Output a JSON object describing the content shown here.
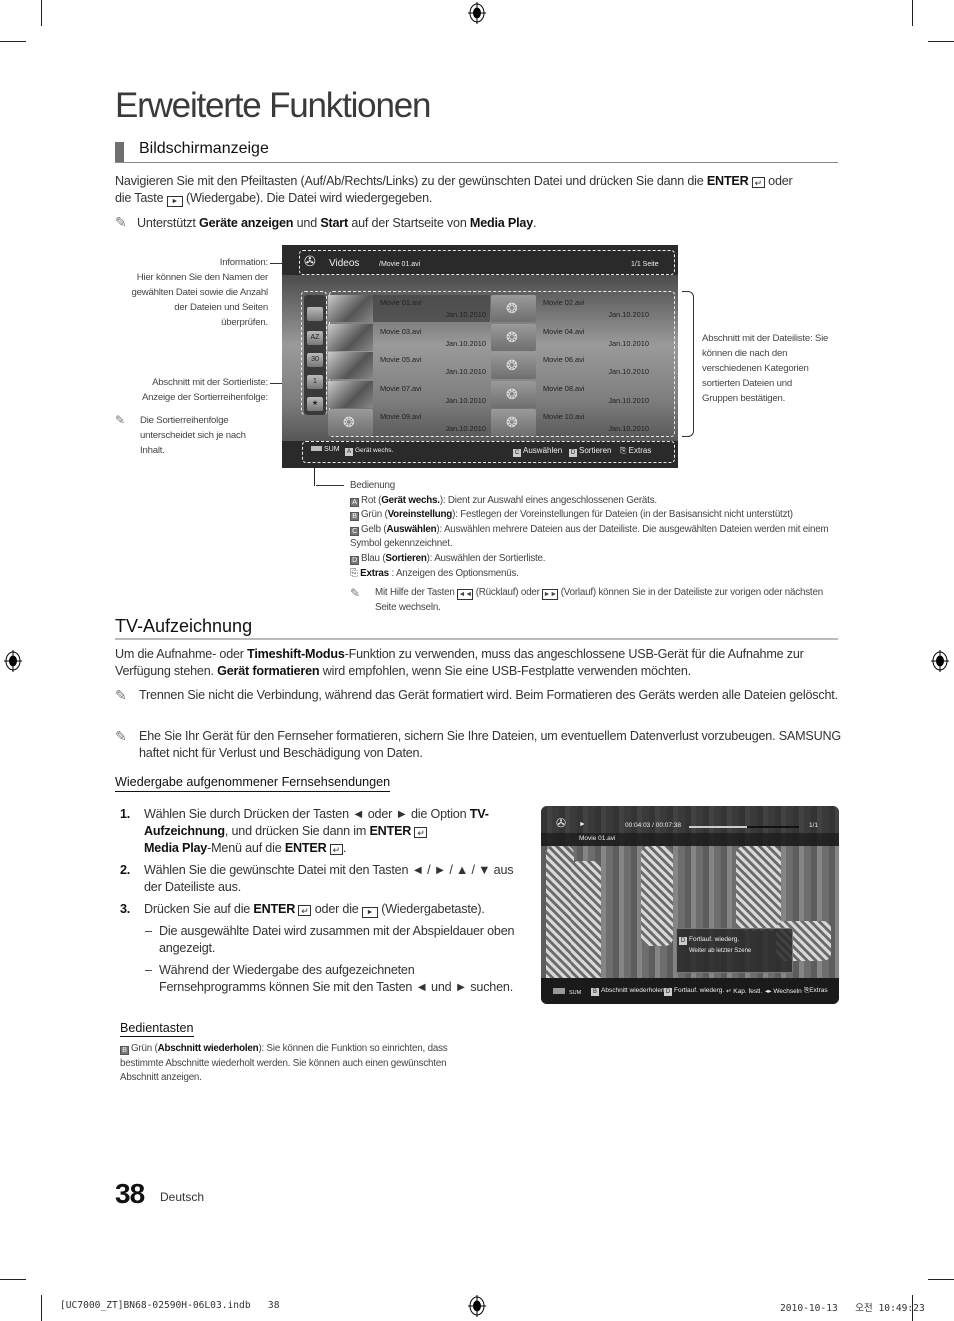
{
  "page": {
    "title": "Erweiterte Funktionen",
    "page_number": "38",
    "language": "Deutsch",
    "print_footer_left": "[UC7000_ZT]BN68-02590H-06L03.indb   38",
    "print_footer_right": "2010-10-13   오전 10:49:23"
  },
  "section1": {
    "title": "Bildschirmanzeige",
    "intro_1": "Navigieren Sie mit den Pfeiltasten (Auf/Ab/Rechts/Links) zu der gewünschten Datei und drücken Sie dann die ",
    "intro_enter": "ENTER",
    "intro_2": " oder",
    "intro_3": "die Taste ",
    "intro_4": " (Wiedergabe). Die Datei wird wiedergegeben.",
    "note_1a": "Unterstützt ",
    "note_1b": "Geräte anzeigen",
    "note_1c": " und ",
    "note_1d": "Start",
    "note_1e": " auf der Startseite von ",
    "note_1f": "Media Play",
    "note_1g": "."
  },
  "annotations": {
    "info_title": "Information:",
    "info_body": "Hier können Sie den Namen der gewählten Datei sowie die Anzahl der Dateien und Seiten überprüfen.",
    "sort_title": "Abschnitt mit der Sortierliste:",
    "sort_body": "Anzeige der Sortierreihenfolge:",
    "sort_note": "Die Sortierreihenfolge unterscheidet sich je nach Inhalt.",
    "filelist": "Abschnitt mit der Dateiliste: Sie können die nach den verschiedenen Kategorien sortierten Dateien und Gruppen bestätigen."
  },
  "tv_browser": {
    "category": "Videos",
    "path": "/Movie 01.avi",
    "page_info": "1/1 Seite",
    "sort_icons": [
      "folder-icon",
      "az-icon",
      "calendar-30-icon",
      "calendar-1-icon",
      "star-icon"
    ],
    "sort_icon_labels": [
      "",
      "AZ",
      "30",
      "1",
      "★"
    ],
    "files": [
      {
        "name": "Movie 01.avi",
        "date": "Jan.10.2010",
        "thumb": "photo",
        "selected": true
      },
      {
        "name": "Movie 02.avi",
        "date": "Jan.10.2010",
        "thumb": "generic",
        "selected": false
      },
      {
        "name": "Movie 03.avi",
        "date": "Jan.10.2010",
        "thumb": "photo",
        "selected": false
      },
      {
        "name": "Movie 04.avi",
        "date": "Jan.10.2010",
        "thumb": "generic",
        "selected": false
      },
      {
        "name": "Movie 05.avi",
        "date": "Jan.10.2010",
        "thumb": "photo",
        "selected": false
      },
      {
        "name": "Movie 06.avi",
        "date": "Jan.10.2010",
        "thumb": "generic",
        "selected": false
      },
      {
        "name": "Movie 07.avi",
        "date": "Jan.10.2010",
        "thumb": "photo",
        "selected": false
      },
      {
        "name": "Movie 08.avi",
        "date": "Jan.10.2010",
        "thumb": "generic",
        "selected": false
      },
      {
        "name": "Movie 09.avi",
        "date": "Jan.10.2010",
        "thumb": "generic",
        "selected": false
      },
      {
        "name": "Movie 10.avi",
        "date": "Jan.10.2010",
        "thumb": "generic",
        "selected": false
      }
    ],
    "footer": {
      "device": "SUM",
      "a_key": "A",
      "a_label": "Gerät wechs.",
      "c_key": "C",
      "c_label": "Auswählen",
      "d_key": "D",
      "d_label": "Sortieren",
      "extras_label": "Extras"
    }
  },
  "controls": {
    "title": "Bedienung",
    "items": [
      {
        "key": "A",
        "pre": "Rot (",
        "bold": "Gerät wechs.",
        "post": "): Dient zur Auswahl eines angeschlossenen Geräts."
      },
      {
        "key": "B",
        "pre": "Grün (",
        "bold": "Voreinstellung",
        "post": "): Festlegen der Voreinstellungen für Dateien (in der Basisansicht nicht unterstützt)"
      },
      {
        "key": "C",
        "pre": "Gelb (",
        "bold": "Auswählen",
        "post": "): Auswählen mehrere Dateien aus der Dateiliste. Die ausgewählten Dateien werden mit einem Symbol gekennzeichnet."
      },
      {
        "key": "D",
        "pre": "Blau (",
        "bold": "Sortieren",
        "post": "): Auswählen der Sortierliste."
      }
    ],
    "extras_bold": "Extras",
    "extras_text": " : Anzeigen des Optionsmenüs.",
    "note_a": "Mit Hilfe der Tasten ",
    "note_b": " (Rücklauf) oder ",
    "note_c": " (Vorlauf) können Sie in der Dateiliste zur vorigen oder nächsten Seite wechseln."
  },
  "section2": {
    "title": "TV-Aufzeichnung",
    "p1a": "Um die Aufnahme- oder ",
    "p1b": "Timeshift-Modus",
    "p1c": "-Funktion zu verwenden, muss das angeschlossene USB-Gerät für die Aufnahme zur Verfügung stehen. ",
    "p1d": "Gerät formatieren",
    "p1e": " wird empfohlen, wenn Sie eine USB-Festplatte verwenden möchten.",
    "note1": "Trennen Sie nicht die Verbindung, während das Gerät formatiert wird. Beim Formatieren des Geräts werden alle Dateien gelöscht.",
    "note2": "Ehe Sie Ihr Gerät für den Fernseher formatieren, sichern Sie Ihre Dateien, um eventuellem Datenverlust vorzubeugen. SAMSUNG haftet nicht für Verlust und Beschädigung von Daten.",
    "subtitle": "Wiedergabe aufgenommener Fernsehsendungen",
    "steps": [
      {
        "num": "1.",
        "a": "Wählen Sie durch Drücken der Tasten ◄ oder ► die Option ",
        "b": "TV-Aufzeichnung",
        "c": ", und drücken Sie dann im ",
        "d": "ENTER",
        "e": "Media Play",
        "f": "-Menü auf die ",
        "g": "ENTER",
        "h": "."
      },
      {
        "num": "2.",
        "a": "Wählen Sie die gewünschte Datei mit den Tasten ◄ / ► / ▲ / ▼ aus der Dateiliste aus."
      },
      {
        "num": "3.",
        "a": "Drücken Sie auf die ",
        "d": "ENTER",
        "c": " oder die ",
        "f": " (Wiedergabetaste)."
      }
    ],
    "bullets": [
      "Die ausgewählte Datei wird zusammen mit der Abspieldauer oben angezeigt.",
      "Während der Wiedergabe des aufgezeichneten Fernsehprogramms können Sie mit den Tasten ◄ und ► suchen."
    ],
    "keys_title": "Bedientasten",
    "keys_text_a": "Grün (",
    "keys_text_b": "Abschnitt wiederholen",
    "keys_text_c": "): Sie können die Funktion so einrichten, dass bestimmte Abschnitte wiederholt werden. Sie können auch einen gewünschten Abschnitt anzeigen."
  },
  "tv_player": {
    "time": "00:04:03 / 00:07:38",
    "progress": 0.53,
    "page": "1/1",
    "filename": "Movie 01.avi",
    "popup_key": "D",
    "popup_title": "Fortlauf. wiederg.",
    "popup_sub": "Weiter ab letzter Szene",
    "footer": {
      "device": "SUM",
      "b_key": "B",
      "b_label": "Abschnitt wiederholen",
      "d_key": "D",
      "d_label": "Fortlauf. wiederg.",
      "chapter": "Kap. festl.",
      "switch": "Wechseln",
      "extras": "Extras"
    }
  }
}
